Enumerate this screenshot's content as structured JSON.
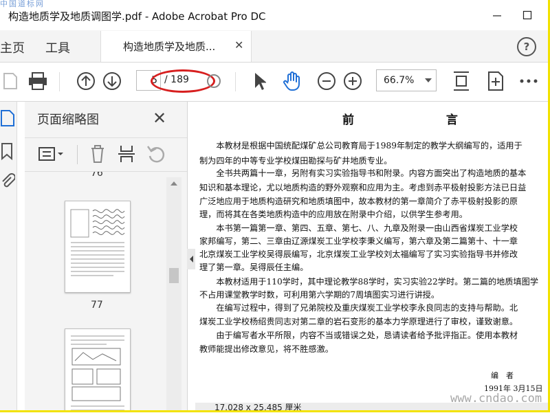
{
  "window": {
    "title": "构造地质学及地质调图学.pdf - Adobe Acrobat Pro DC",
    "watermark_top": "中国道标网"
  },
  "menubar": {
    "home": "主页",
    "tools": "工具",
    "doc_tab": "构造地质学及地质...",
    "help": "?"
  },
  "toolbar": {
    "page_current": "5",
    "page_total": "/ 189",
    "zoom": "66.7%"
  },
  "thumbnails_panel": {
    "title": "页面缩略图",
    "page_numbers": [
      "76",
      "77"
    ]
  },
  "page": {
    "heading": "前 言",
    "lines": [
      "　　本教材是根据中国统配煤矿总公司教育局于1989年制定的教学大纲编写的，适用于",
      "制为四年的中等专业学校煤田勘探与矿井地质专业。",
      "　　全书共两篇十一章，另附有实习实验指导书和附录。内容方面突出了构造地质的基本",
      "知识和基本理论，尤以地质构造的野外观察和应用为主。考虑到赤平极射投影方法已日益",
      "广泛地应用于地质构造研究和地质填图中，故本教材的第一章简介了赤平极射投影的原",
      "理，而将其在各类地质构造中的应用放在附录中介绍，以供学生参考用。",
      "　　本书第一篇第一章、第四、五章、第七、八、九章及附录一由山西省煤炭工业学校",
      "家邦编写，第二、三章由辽源煤炭工业学校李秉义编写，第六章及第二篇第十、十一章",
      "北京煤炭工业学校吴得辰编写，北京煤炭工业学校刘太福编写了实习实验指导书并修改",
      "理了第一章。吴得辰任主编。",
      "　　本教材适用于110学时，其中理论教学88学时，实习实验22学时。第二篇的地质填图学",
      "不占用课堂教学时数，可利用第六学期的7周填图实习进行讲授。",
      "　　在编写过程中，得到了兄弟院校及重庆煤炭工业学校李永良同志的支持与帮助。北",
      "煤炭工业学校杨绍贵同志对第二章的岩石变形的基本力学原理进行了审校，谨致谢意。",
      "　　由于编写者水平所限，内容不当或错误之处，恳请读者给予批评指正。使用本教材",
      "教师能提出修改意见，将不胜感激。"
    ],
    "sign_author": "编　者",
    "sign_date": "1991年 3月15日"
  },
  "statusbar": {
    "dimensions": "17.028 x 25.485 厘米"
  },
  "watermark_bottom": "www.cndao.com",
  "colors": {
    "annotation_oval": "#d71f1f",
    "hand_tool_active": "#1f6fd6",
    "frame_border": "#f2e200"
  },
  "icons": [
    "save-icon",
    "print-icon",
    "prev-page-icon",
    "next-page-icon",
    "select-arrow-icon",
    "hand-tool-icon",
    "zoom-out-icon",
    "zoom-in-icon",
    "fit-page-icon",
    "rotate-scroll-icon",
    "more-icon",
    "thumbnail-icon",
    "bookmark-icon",
    "attachment-icon",
    "options-icon",
    "delete-icon",
    "insert-page-icon",
    "undo-icon",
    "help-icon",
    "close-icon"
  ]
}
